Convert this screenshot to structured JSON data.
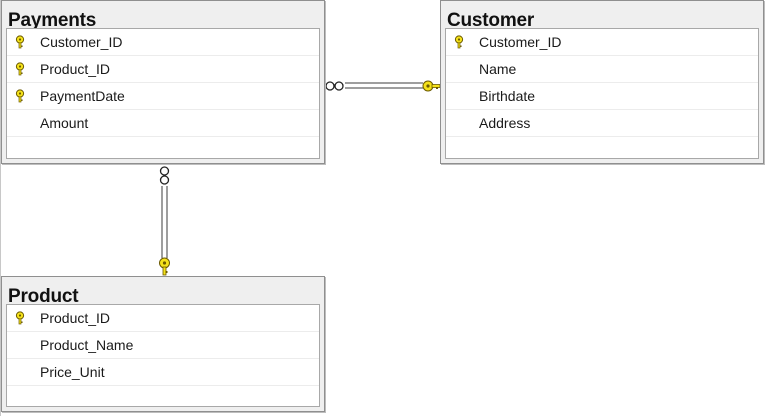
{
  "tables": {
    "payments": {
      "title": "Payments",
      "columns": [
        {
          "name": "Customer_ID",
          "key": true
        },
        {
          "name": "Product_ID",
          "key": true
        },
        {
          "name": "PaymentDate",
          "key": true
        },
        {
          "name": "Amount",
          "key": false
        }
      ]
    },
    "customer": {
      "title": "Customer",
      "columns": [
        {
          "name": "Customer_ID",
          "key": true
        },
        {
          "name": "Name",
          "key": false
        },
        {
          "name": "Birthdate",
          "key": false
        },
        {
          "name": "Address",
          "key": false
        }
      ]
    },
    "product": {
      "title": "Product",
      "columns": [
        {
          "name": "Product_ID",
          "key": true
        },
        {
          "name": "Product_Name",
          "key": false
        },
        {
          "name": "Price_Unit",
          "key": false
        }
      ]
    }
  },
  "relationships": [
    {
      "from": "payments",
      "to": "customer",
      "from_end": "many",
      "to_end": "one"
    },
    {
      "from": "payments",
      "to": "product",
      "from_end": "many",
      "to_end": "one"
    }
  ],
  "colors": {
    "key_fill": "#f5e21a",
    "key_stroke": "#6b5a00",
    "line": "#3c3c3c"
  }
}
